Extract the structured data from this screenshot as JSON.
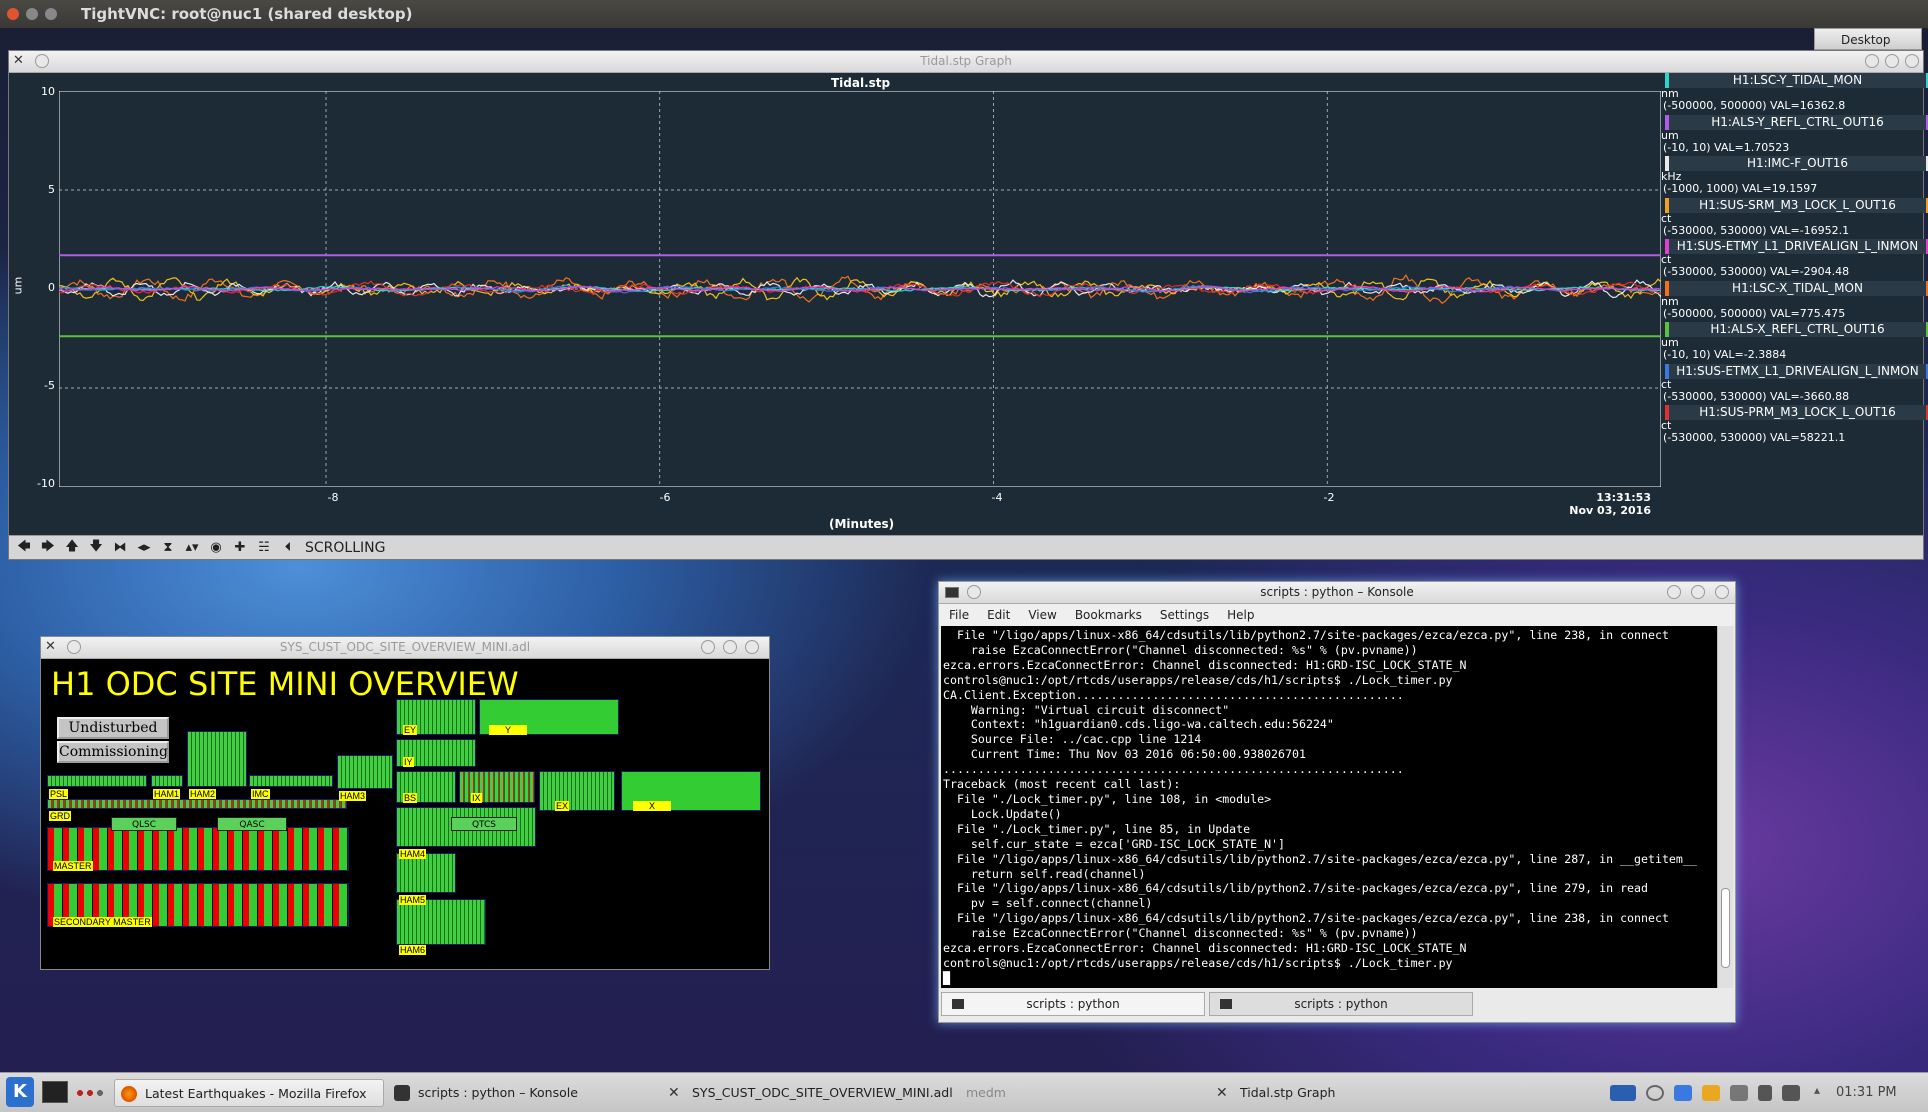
{
  "vnc": {
    "title": "TightVNC: root@nuc1 (shared desktop)",
    "desktop_tab": "Desktop"
  },
  "striptool": {
    "window_title": "Tidal.stp Graph",
    "plot_title": "Tidal.stp",
    "y_unit": "um",
    "x_label": "(Minutes)",
    "time": "13:31:53",
    "date": "Nov 03, 2016",
    "mode": "SCROLLING",
    "legend": [
      {
        "name": "H1:LSC-Y_TIDAL_MON",
        "unit": "nm",
        "range": "(-500000, 500000) VAL=16362.8",
        "color": "#2ad6c8"
      },
      {
        "name": "H1:ALS-Y_REFL_CTRL_OUT16",
        "unit": "um",
        "range": "(-10, 10) VAL=1.70523",
        "color": "#b15ce8"
      },
      {
        "name": "H1:IMC-F_OUT16",
        "unit": "kHz",
        "range": "(-1000, 1000) VAL=19.1597",
        "color": "#e8e8e8"
      },
      {
        "name": "H1:SUS-SRM_M3_LOCK_L_OUT16",
        "unit": "ct",
        "range": "(-530000, 530000) VAL=-16952.1",
        "color": "#f0a020"
      },
      {
        "name": "H1:SUS-ETMY_L1_DRIVEALIGN_L_INMON",
        "unit": "ct",
        "range": "(-530000, 530000) VAL=-2904.48",
        "color": "#e040d0"
      },
      {
        "name": "H1:LSC-X_TIDAL_MON",
        "unit": "nm",
        "range": "(-500000, 500000) VAL=775.475",
        "color": "#f07020"
      },
      {
        "name": "H1:ALS-X_REFL_CTRL_OUT16",
        "unit": "um",
        "range": "(-10, 10) VAL=-2.3884",
        "color": "#5cc040"
      },
      {
        "name": "H1:SUS-ETMX_L1_DRIVEALIGN_L_INMON",
        "unit": "ct",
        "range": "(-530000, 530000) VAL=-3660.88",
        "color": "#3a7ae0"
      },
      {
        "name": "H1:SUS-PRM_M3_LOCK_L_OUT16",
        "unit": "ct",
        "range": "(-530000, 530000) VAL=58221.1",
        "color": "#e03030"
      }
    ]
  },
  "chart_data": {
    "type": "line",
    "title": "Tidal.stp",
    "xlabel": "(Minutes)",
    "ylabel": "um",
    "x_ticks": [
      "-8",
      "-6",
      "-4",
      "-2"
    ],
    "y_ticks": [
      "10",
      "5",
      "0",
      "-5",
      "-10"
    ],
    "xlim": [
      -9.6,
      0
    ],
    "ylim": [
      -10,
      10
    ],
    "grid": true,
    "series": [
      {
        "name": "H1:ALS-Y_REFL_CTRL_OUT16",
        "constant": 1.70523,
        "color": "#b15ce8"
      },
      {
        "name": "H1:ALS-X_REFL_CTRL_OUT16",
        "constant": -2.3884,
        "color": "#5cc040"
      }
    ]
  },
  "medm": {
    "window_title": "SYS_CUST_ODC_SITE_OVERVIEW_MINI.adl",
    "heading": "H1 ODC SITE MINI OVERVIEW",
    "btn_undisturbed": "Undisturbed",
    "btn_commissioning": "Commissioning",
    "tags": {
      "ey": "EY",
      "y": "Y",
      "iy": "IY",
      "bs": "BS",
      "ix": "IX",
      "ex": "EX",
      "x": "X",
      "psl": "PSL",
      "ham1": "HAM1",
      "ham2": "HAM2",
      "imc": "IMC",
      "ham3": "HAM3",
      "ham4": "HAM4",
      "ham5": "HAM5",
      "ham6": "HAM6",
      "grd": "GRD",
      "master": "MASTER",
      "secondary": "SECONDARY MASTER"
    },
    "qbuttons": {
      "qlsc": "QLSC",
      "qasc": "QASC",
      "qtcs": "QTCS"
    }
  },
  "konsole": {
    "window_title": "scripts : python – Konsole",
    "menu": [
      "File",
      "Edit",
      "View",
      "Bookmarks",
      "Settings",
      "Help"
    ],
    "lines": [
      "  File \"/ligo/apps/linux-x86_64/cdsutils/lib/python2.7/site-packages/ezca/ezca.py\", line 238, in connect",
      "    raise EzcaConnectError(\"Channel disconnected: %s\" % (pv.pvname))",
      "ezca.errors.EzcaConnectError: Channel disconnected: H1:GRD-ISC_LOCK_STATE_N",
      "controls@nuc1:/opt/rtcds/userapps/release/cds/h1/scripts$ ./Lock_timer.py",
      "CA.Client.Exception...............................................",
      "    Warning: \"Virtual circuit disconnect\"",
      "    Context: \"h1guardian0.cds.ligo-wa.caltech.edu:56224\"",
      "    Source File: ../cac.cpp line 1214",
      "    Current Time: Thu Nov 03 2016 06:50:00.938026701",
      "..................................................................",
      "Traceback (most recent call last):",
      "  File \"./Lock_timer.py\", line 108, in <module>",
      "    Lock.Update()",
      "  File \"./Lock_timer.py\", line 85, in Update",
      "    self.cur_state = ezca['GRD-ISC_LOCK_STATE_N']",
      "  File \"/ligo/apps/linux-x86_64/cdsutils/lib/python2.7/site-packages/ezca/ezca.py\", line 287, in __getitem__",
      "    return self.read(channel)",
      "  File \"/ligo/apps/linux-x86_64/cdsutils/lib/python2.7/site-packages/ezca/ezca.py\", line 279, in read",
      "    pv = self.connect(channel)",
      "  File \"/ligo/apps/linux-x86_64/cdsutils/lib/python2.7/site-packages/ezca/ezca.py\", line 238, in connect",
      "    raise EzcaConnectError(\"Channel disconnected: %s\" % (pv.pvname))",
      "ezca.errors.EzcaConnectError: Channel disconnected: H1:GRD-ISC_LOCK_STATE_N",
      "controls@nuc1:/opt/rtcds/userapps/release/cds/h1/scripts$ ./Lock_timer.py",
      "█"
    ],
    "tabs": [
      "scripts : python",
      "scripts : python"
    ]
  },
  "taskbar": {
    "tasks": [
      "Latest Earthquakes - Mozilla Firefox",
      "scripts : python – Konsole",
      "SYS_CUST_ODC_SITE_OVERVIEW_MINI.adl",
      "medm",
      "Tidal.stp Graph"
    ],
    "clock": "01:31 PM"
  }
}
